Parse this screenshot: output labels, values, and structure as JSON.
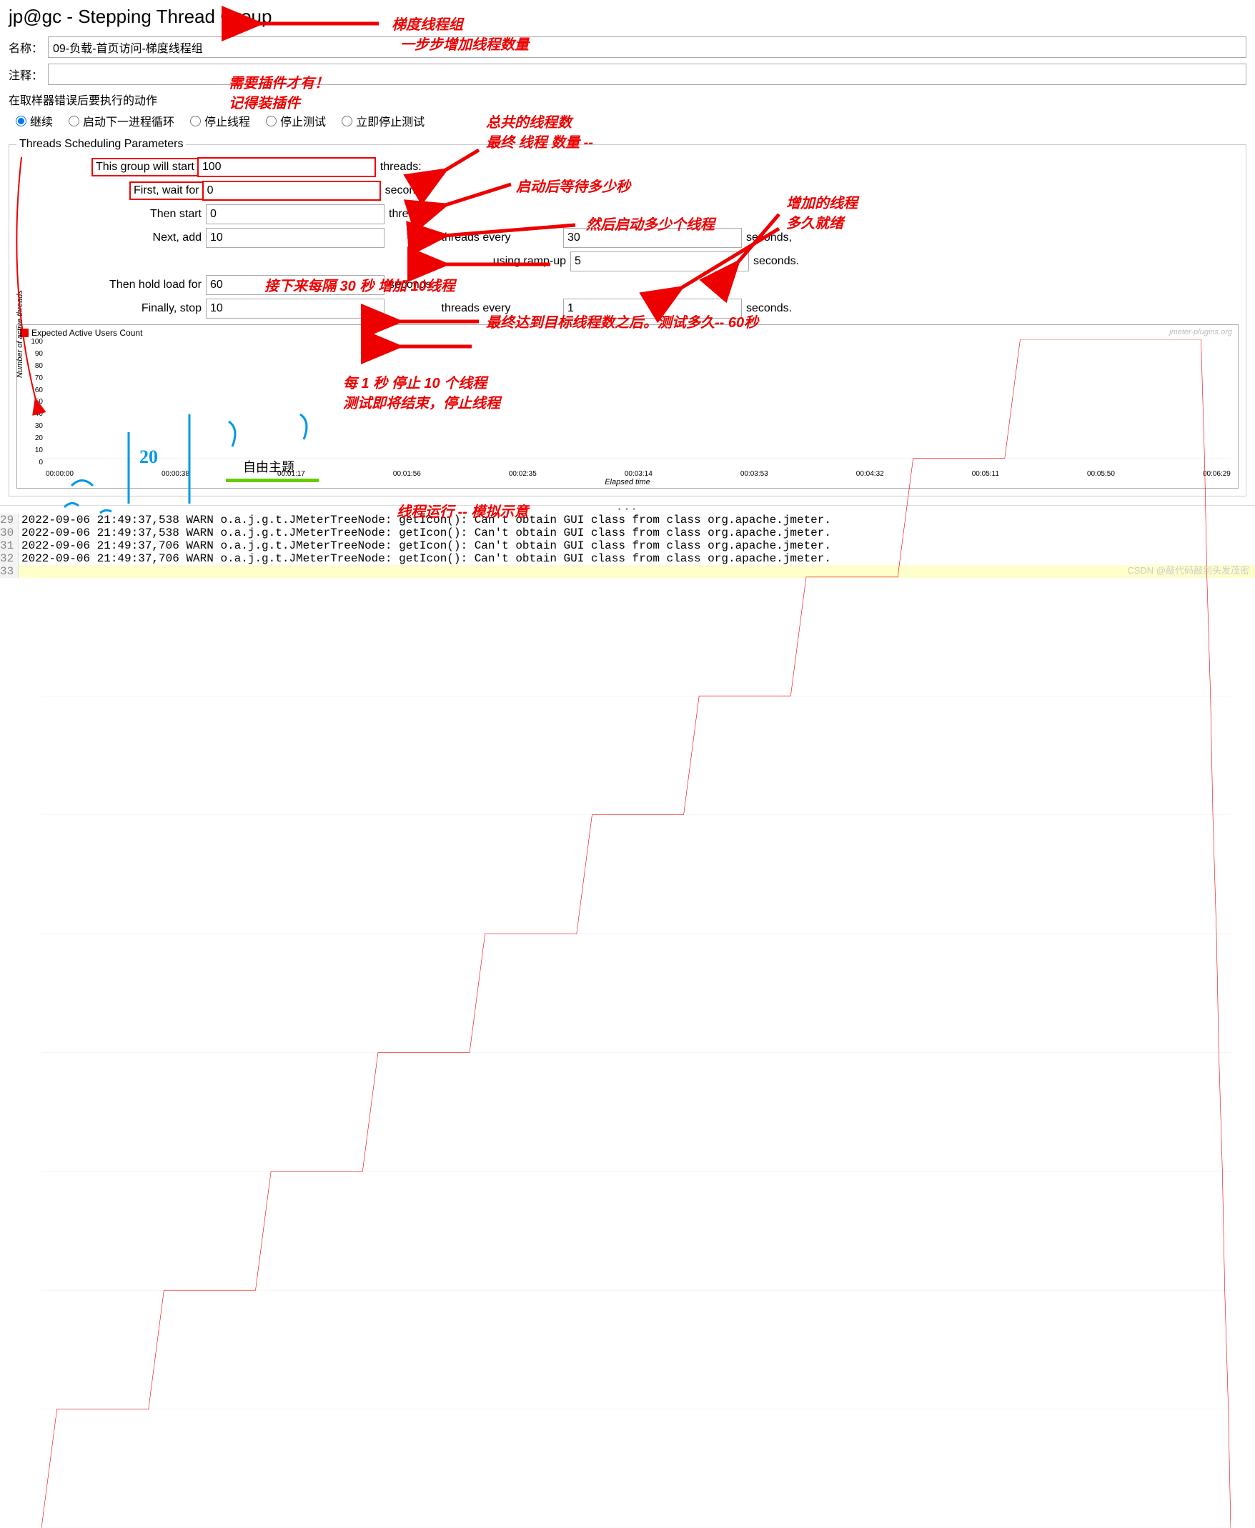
{
  "title": "jp@gc - Stepping Thread Group",
  "form": {
    "name_label": "名称：",
    "name_value": "09-负载-首页访问-梯度线程组",
    "comment_label": "注释：",
    "comment_value": ""
  },
  "error_action": {
    "label": "在取样器错误后要执行的动作",
    "opts": {
      "continue": "继续",
      "next_loop": "启动下一进程循环",
      "stop_thread": "停止线程",
      "stop_test": "停止测试",
      "stop_now": "立即停止测试"
    }
  },
  "fieldset_legend": "Threads Scheduling Parameters",
  "params": {
    "start_label": "This group will start",
    "start_value": "100",
    "start_suffix": "threads:",
    "wait_label": "First, wait for",
    "wait_value": "0",
    "wait_suffix": "seconds;",
    "then_label": "Then start",
    "then_value": "0",
    "then_suffix": "threads;",
    "add_label": "Next, add",
    "add_value": "10",
    "add_mid": "threads every",
    "add_every_value": "30",
    "add_suffix": "seconds,",
    "ramp_label": "using ramp-up",
    "ramp_value": "5",
    "ramp_suffix": "seconds.",
    "hold_label": "Then hold load for",
    "hold_value": "60",
    "hold_suffix": "seconds.",
    "stop_label": "Finally, stop",
    "stop_value": "10",
    "stop_mid": "threads every",
    "stop_every_value": "1",
    "stop_suffix": "seconds."
  },
  "chart": {
    "legend": "Expected Active Users Count",
    "ylabel": "Number of active threads",
    "xlabel": "Elapsed time",
    "watermark": "jmeter-plugins.org"
  },
  "chart_data": {
    "type": "line",
    "title": "Expected Active Users Count",
    "xlabel": "Elapsed time",
    "ylabel": "Number of active threads",
    "ylim": [
      0,
      100
    ],
    "y_ticks": [
      100,
      90,
      80,
      70,
      60,
      50,
      40,
      30,
      20,
      10,
      0
    ],
    "x_ticks": [
      "00:00:00",
      "00:00:38",
      "00:01:17",
      "00:01:56",
      "00:02:35",
      "00:03:14",
      "00:03:53",
      "00:04:32",
      "00:05:11",
      "00:05:50",
      "00:06:29"
    ],
    "series": [
      {
        "name": "Expected Active Users Count",
        "points_normalized": [
          [
            0,
            0
          ],
          [
            0.013,
            10
          ],
          [
            0.09,
            10
          ],
          [
            0.103,
            20
          ],
          [
            0.18,
            20
          ],
          [
            0.193,
            30
          ],
          [
            0.27,
            30
          ],
          [
            0.283,
            40
          ],
          [
            0.36,
            40
          ],
          [
            0.373,
            50
          ],
          [
            0.45,
            50
          ],
          [
            0.463,
            60
          ],
          [
            0.54,
            60
          ],
          [
            0.553,
            70
          ],
          [
            0.63,
            70
          ],
          [
            0.643,
            80
          ],
          [
            0.72,
            80
          ],
          [
            0.733,
            90
          ],
          [
            0.81,
            90
          ],
          [
            0.823,
            100
          ],
          [
            0.975,
            100
          ],
          [
            0.978,
            90
          ],
          [
            0.98,
            80
          ],
          [
            0.983,
            70
          ],
          [
            0.985,
            60
          ],
          [
            0.988,
            50
          ],
          [
            0.99,
            40
          ],
          [
            0.993,
            30
          ],
          [
            0.995,
            20
          ],
          [
            0.998,
            10
          ],
          [
            1,
            0
          ]
        ]
      }
    ]
  },
  "log": {
    "lines": [
      {
        "n": "29",
        "t": "2022-09-06 21:49:37,538 WARN o.a.j.g.t.JMeterTreeNode: getIcon(): Can't obtain GUI class from class org.apache.jmeter."
      },
      {
        "n": "30",
        "t": "2022-09-06 21:49:37,538 WARN o.a.j.g.t.JMeterTreeNode: getIcon(): Can't obtain GUI class from class org.apache.jmeter."
      },
      {
        "n": "31",
        "t": "2022-09-06 21:49:37,706 WARN o.a.j.g.t.JMeterTreeNode: getIcon(): Can't obtain GUI class from class org.apache.jmeter."
      },
      {
        "n": "32",
        "t": "2022-09-06 21:49:37,706 WARN o.a.j.g.t.JMeterTreeNode: getIcon(): Can't obtain GUI class from class org.apache.jmeter."
      },
      {
        "n": "33",
        "t": " "
      }
    ]
  },
  "annotations": {
    "a1a": "梯度线程组",
    "a1b": "一步步增加线程数量",
    "a2a": "需要插件才有！",
    "a2b": "记得装插件",
    "a3a": "总共的线程数",
    "a3b": "最终 线程 数量 --",
    "a4": "启动后等待多少秒",
    "a5": "然后启动多少个线程",
    "a6a": "增加的线程",
    "a6b": "多久就绪",
    "a7": "接下来每隔 30 秒 增加 10线程",
    "a8": "最终达到目标线程数之后。测试多久-- 60秒",
    "a9a": "每 1 秒 停止 10 个线程",
    "a9b": "测试即将结束，停止线程",
    "a10": "线程运行 -- 模拟示意",
    "a11": "自由主题",
    "blue1": "20"
  },
  "footer": "CSDN @敲代码敲到头发茂密"
}
